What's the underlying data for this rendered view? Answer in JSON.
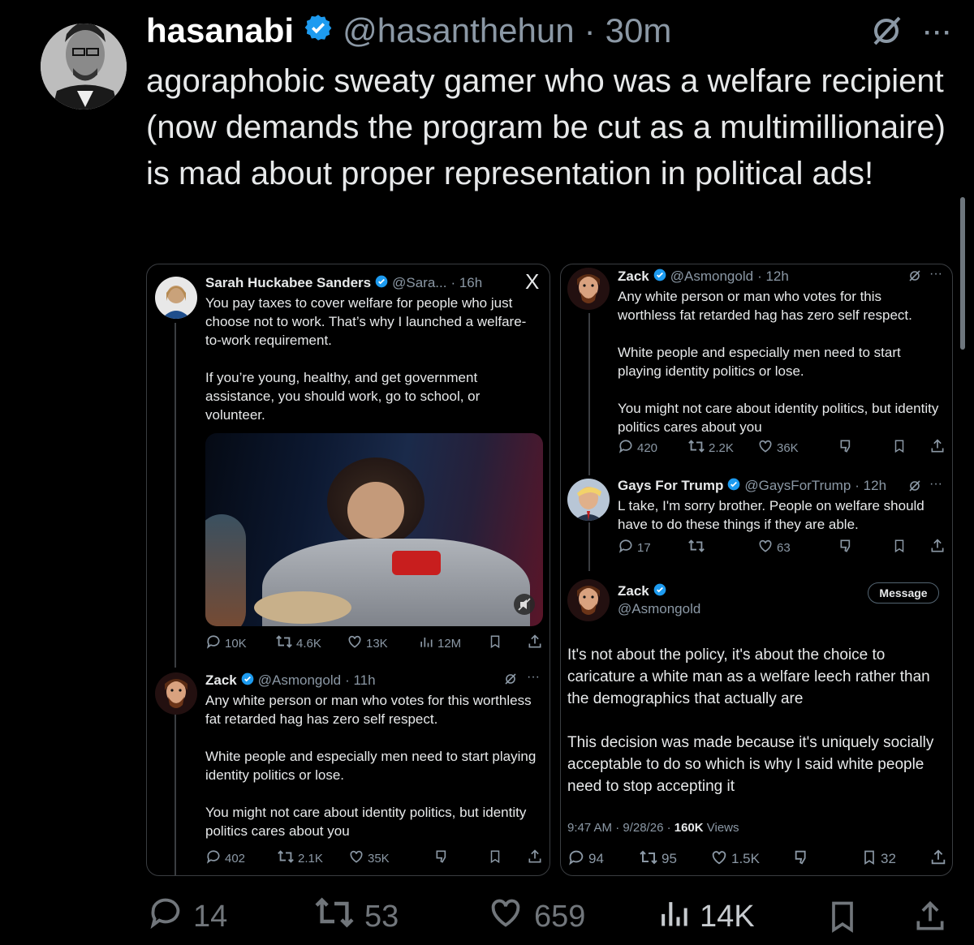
{
  "post": {
    "author_name": "hasanabi",
    "author_handle": "@hasanthehun",
    "dot": "·",
    "time": "30m",
    "text": "agoraphobic sweaty gamer who was a welfare recipient (now demands the program be cut as a multimillionaire) is mad about proper representation in political ads!",
    "more_glyph": "···",
    "stats": {
      "replies": "14",
      "reposts": "53",
      "likes": "659",
      "views": "14K"
    }
  },
  "left_card": {
    "close_glyph": "X",
    "tweet1": {
      "name": "Sarah Huckabee Sanders",
      "handle": "@Sara...",
      "time": "· 16h",
      "p1": "You pay taxes to cover welfare for people who just choose not to work. That’s why I launched a welfare-to-work requirement.",
      "p2": "If you’re young, healthy, and get government assistance, you should work, go to school, or volunteer.",
      "replies": "10K",
      "reposts": "4.6K",
      "likes": "13K",
      "views": "12M"
    },
    "tweet2": {
      "name": "Zack",
      "handle": "@Asmongold",
      "time": "· 11h",
      "p1": "Any white person or man who votes for this worthless fat retarded hag has zero self respect.",
      "p2": "White people and especially men need to start playing identity politics or lose.",
      "p3": "You might not care about identity politics, but identity politics cares about you",
      "replies": "402",
      "reposts": "2.1K",
      "likes": "35K",
      "more_glyph": "···"
    }
  },
  "right_card": {
    "tweet1": {
      "name": "Zack",
      "handle": "@Asmongold",
      "time": "· 12h",
      "p1": "Any white person or man who votes for this worthless fat retarded hag has zero self respect.",
      "p2": "White people and especially men need to start playing identity politics or lose.",
      "p3": "You might not care about identity politics, but identity politics cares about you",
      "replies": "420",
      "reposts": "2.2K",
      "likes": "36K",
      "more_glyph": "···"
    },
    "tweet2": {
      "name": "Gays For Trump",
      "handle": "@GaysForTrump",
      "time": "· 12h",
      "p1": "L take, I'm sorry brother. People on welfare should have to do these things if they are able.",
      "replies": "17",
      "likes": "63",
      "more_glyph": "···"
    },
    "tweet3": {
      "name": "Zack",
      "handle": "@Asmongold",
      "message_label": "Message",
      "p1": "It's not about the policy, it's about the choice to caricature a white man as a welfare leech rather than the demographics that actually are",
      "p2": "This decision was made because it's uniquely socially acceptable to do so which is why I said white people need to stop accepting it",
      "timestamp": "9:47 AM · 9/28/26 · ",
      "views_count": "160K",
      "views_label": " Views",
      "replies": "94",
      "reposts": "95",
      "likes": "1.5K",
      "bookmarks": "32"
    }
  }
}
